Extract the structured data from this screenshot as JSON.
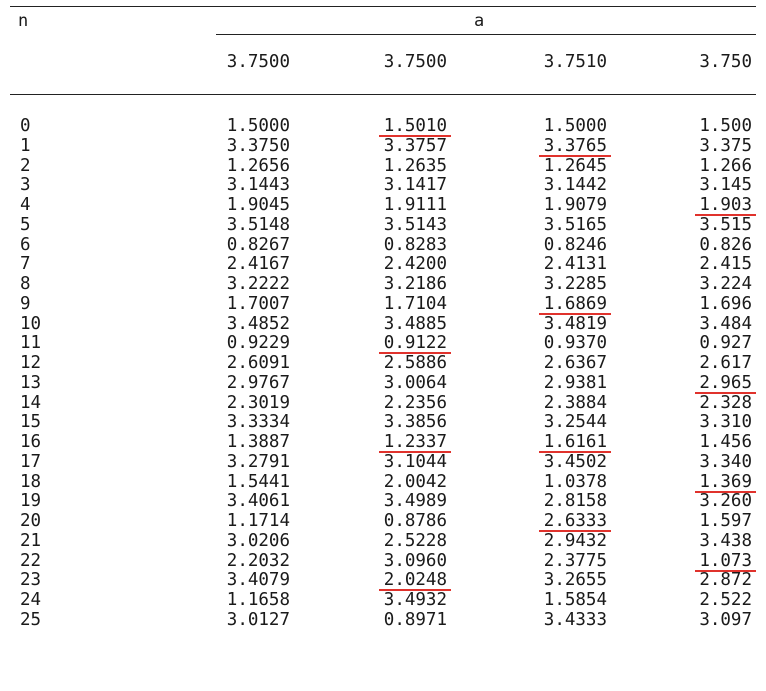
{
  "table": {
    "index_header": "n",
    "group_header": "a",
    "columns": [
      "3.7500",
      "3.7500",
      "3.7510",
      "3.750"
    ],
    "rows": [
      {
        "n": "0",
        "v": [
          "1.5000",
          "1.5010",
          "1.5000",
          "1.500"
        ]
      },
      {
        "n": "1",
        "v": [
          "3.3750",
          "3.3757",
          "3.3765",
          "3.375"
        ]
      },
      {
        "n": "2",
        "v": [
          "1.2656",
          "1.2635",
          "1.2645",
          "1.266"
        ]
      },
      {
        "n": "3",
        "v": [
          "3.1443",
          "3.1417",
          "3.1442",
          "3.145"
        ]
      },
      {
        "n": "4",
        "v": [
          "1.9045",
          "1.9111",
          "1.9079",
          "1.903"
        ]
      },
      {
        "n": "5",
        "v": [
          "3.5148",
          "3.5143",
          "3.5165",
          "3.515"
        ]
      },
      {
        "n": "6",
        "v": [
          "0.8267",
          "0.8283",
          "0.8246",
          "0.826"
        ]
      },
      {
        "n": "7",
        "v": [
          "2.4167",
          "2.4200",
          "2.4131",
          "2.415"
        ]
      },
      {
        "n": "8",
        "v": [
          "3.2222",
          "3.2186",
          "3.2285",
          "3.224"
        ]
      },
      {
        "n": "9",
        "v": [
          "1.7007",
          "1.7104",
          "1.6869",
          "1.696"
        ]
      },
      {
        "n": "10",
        "v": [
          "3.4852",
          "3.4885",
          "3.4819",
          "3.484"
        ]
      },
      {
        "n": "11",
        "v": [
          "0.9229",
          "0.9122",
          "0.9370",
          "0.927"
        ]
      },
      {
        "n": "12",
        "v": [
          "2.6091",
          "2.5886",
          "2.6367",
          "2.617"
        ]
      },
      {
        "n": "13",
        "v": [
          "2.9767",
          "3.0064",
          "2.9381",
          "2.965"
        ]
      },
      {
        "n": "14",
        "v": [
          "2.3019",
          "2.2356",
          "2.3884",
          "2.328"
        ]
      },
      {
        "n": "15",
        "v": [
          "3.3334",
          "3.3856",
          "3.2544",
          "3.310"
        ]
      },
      {
        "n": "16",
        "v": [
          "1.3887",
          "1.2337",
          "1.6161",
          "1.456"
        ]
      },
      {
        "n": "17",
        "v": [
          "3.2791",
          "3.1044",
          "3.4502",
          "3.340"
        ]
      },
      {
        "n": "18",
        "v": [
          "1.5441",
          "2.0042",
          "1.0378",
          "1.369"
        ]
      },
      {
        "n": "19",
        "v": [
          "3.4061",
          "3.4989",
          "2.8158",
          "3.260"
        ]
      },
      {
        "n": "20",
        "v": [
          "1.1714",
          "0.8786",
          "2.6333",
          "1.597"
        ]
      },
      {
        "n": "21",
        "v": [
          "3.0206",
          "2.5228",
          "2.9432",
          "3.438"
        ]
      },
      {
        "n": "22",
        "v": [
          "2.2032",
          "3.0960",
          "2.3775",
          "1.073"
        ]
      },
      {
        "n": "23",
        "v": [
          "3.4079",
          "2.0248",
          "3.2655",
          "2.872"
        ]
      },
      {
        "n": "24",
        "v": [
          "1.1658",
          "3.4932",
          "1.5854",
          "2.522"
        ]
      },
      {
        "n": "25",
        "v": [
          "3.0127",
          "0.8971",
          "3.4333",
          "3.097"
        ]
      }
    ],
    "underlined": [
      {
        "row": 0,
        "col": 1
      },
      {
        "row": 1,
        "col": 2
      },
      {
        "row": 4,
        "col": 3
      },
      {
        "row": 9,
        "col": 2
      },
      {
        "row": 11,
        "col": 1
      },
      {
        "row": 13,
        "col": 3
      },
      {
        "row": 16,
        "col": 1
      },
      {
        "row": 16,
        "col": 2
      },
      {
        "row": 18,
        "col": 3
      },
      {
        "row": 20,
        "col": 2
      },
      {
        "row": 22,
        "col": 3
      },
      {
        "row": 23,
        "col": 1
      }
    ],
    "underline_color": "#e0322c",
    "rule_color": "#222222"
  }
}
